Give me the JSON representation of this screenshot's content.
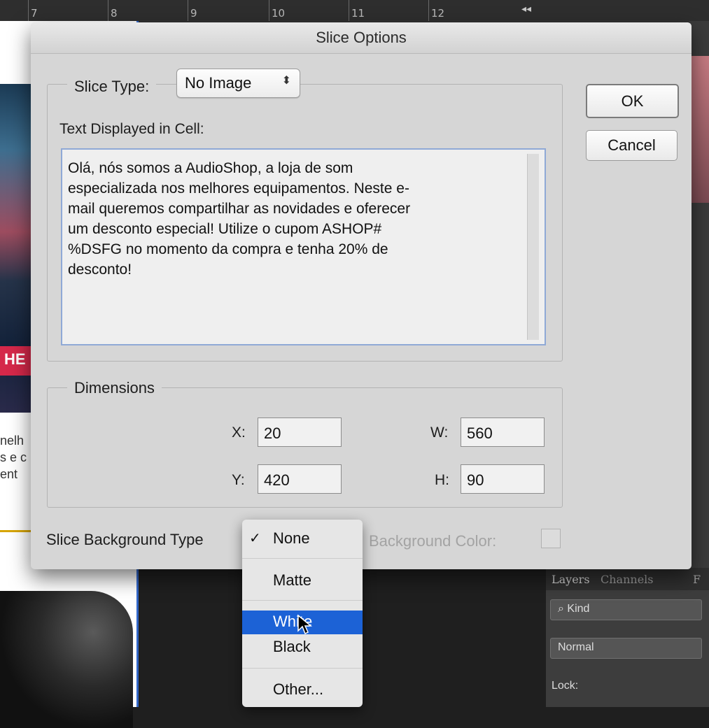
{
  "ruler": {
    "numbers": [
      "7",
      "8",
      "9",
      "10",
      "11",
      "12"
    ],
    "collapse_glyph": "◂◂"
  },
  "background": {
    "banner_letters": "HE",
    "doc_text_lines": [
      "nelh",
      "s e c",
      "ent"
    ],
    "layers_panel": {
      "tabs": [
        "Layers",
        "Channels",
        "F"
      ],
      "kind_filter": "Kind",
      "blend_mode": "Normal",
      "lock_label": "Lock:"
    }
  },
  "dialog": {
    "title": "Slice Options",
    "slice_type_label": "Slice Type:",
    "slice_type_value": "No Image",
    "text_cell_label": "Text Displayed in Cell:",
    "text_lines": [
      "Olá, nós somos a AudioShop, a loja de som",
      "especializada nos melhores equipamentos. Neste e-",
      "mail queremos compartilhar as novidades e oferecer",
      "um desconto especial! Utilize o cupom ASHOP#",
      "%DSFG no momento da compra e tenha 20% de",
      "desconto!"
    ],
    "ok_label": "OK",
    "cancel_label": "Cancel",
    "dimensions_label": "Dimensions",
    "x_label": "X:",
    "x_value": "20",
    "y_label": "Y:",
    "y_value": "420",
    "w_label": "W:",
    "w_value": "560",
    "h_label": "H:",
    "h_value": "90",
    "bg_type_label": "Slice Background Type",
    "bg_color_label": "Background Color:"
  },
  "bg_type_menu": {
    "selected": "None",
    "highlighted": "White",
    "items": [
      "None",
      "Matte",
      "White",
      "Black",
      "Other..."
    ],
    "checkmark": "✓"
  },
  "colors": {
    "highlight": "#1c62d6",
    "dialog_bg": "#d6d6d6",
    "focus_border": "#8fa9d6"
  }
}
